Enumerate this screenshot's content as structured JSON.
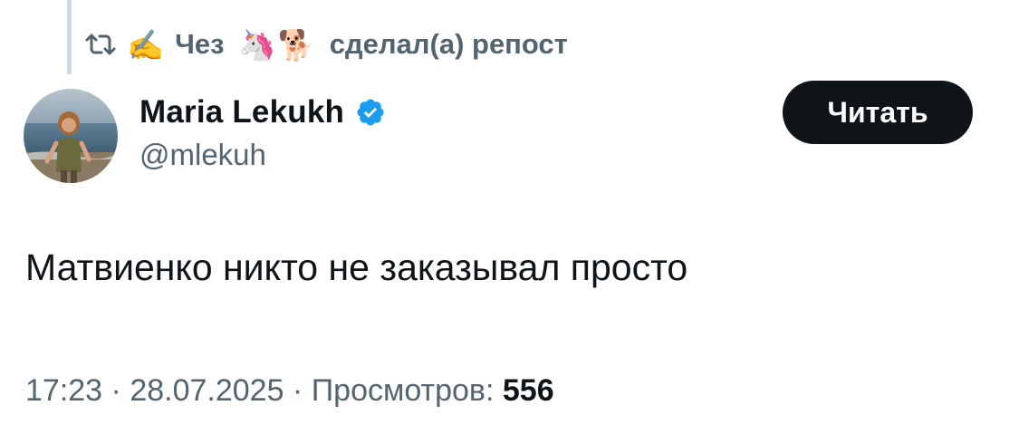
{
  "repost": {
    "icon": "repost-icon",
    "lead_emoji": "✍️",
    "user_name": "Чез",
    "emojis": [
      "🦄",
      "🐕"
    ],
    "suffix": "сделал(а) репост"
  },
  "author": {
    "display_name": "Maria Lekukh",
    "handle": "@mlekuh",
    "verified": true,
    "avatar": "avatar-photo"
  },
  "follow_button": {
    "label": "Читать"
  },
  "tweet": {
    "text": "Матвиенко никто не заказывал просто"
  },
  "meta": {
    "time": "17:23",
    "separator": "·",
    "date": "28.07.2025",
    "views_label": "Просмотров:",
    "views_count": "556"
  },
  "colors": {
    "text_primary": "#0f1419",
    "text_secondary": "#536471",
    "verified_blue": "#1d9bf0",
    "button_bg": "#0f1419",
    "thread_line": "#cfd9de"
  }
}
